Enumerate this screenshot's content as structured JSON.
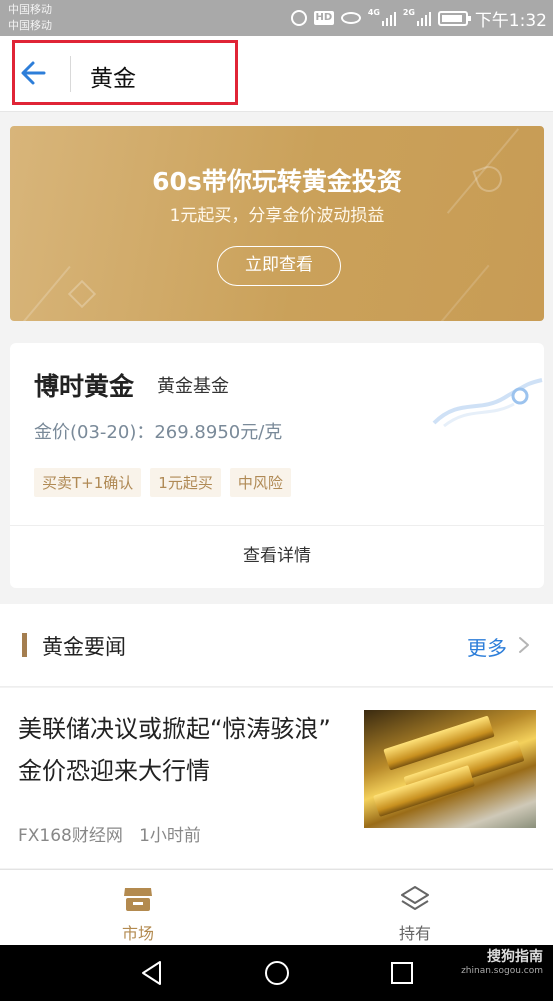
{
  "status_bar": {
    "carrier1": "中国移动",
    "carrier2": "中国移动",
    "hd": "HD",
    "net1": "4G",
    "net2": "2G",
    "time": "下午1:32"
  },
  "header": {
    "title": "黄金",
    "back_icon": "arrow-left-icon"
  },
  "banner": {
    "title": "60s带你玩转黄金投资",
    "subtitle": "1元起买，分享金价波动损益",
    "button_label": "立即查看"
  },
  "fund_card": {
    "name": "博时黄金",
    "type": "黄金基金",
    "price_line": "金价(03-20)：269.8950元/克",
    "tags": [
      "买卖T+1确认",
      "1元起买",
      "中风险"
    ],
    "link_label": "查看详情"
  },
  "news_section": {
    "title": "黄金要闻",
    "more_label": "更多"
  },
  "news_items": [
    {
      "title": "美联储决议或掀起“惊涛骇浪” 金价恐迎来大行情",
      "source": "FX168财经网",
      "time": "1小时前"
    }
  ],
  "tab_bar": {
    "tabs": [
      {
        "label": "市场",
        "icon": "store-icon",
        "active": true
      },
      {
        "label": "持有",
        "icon": "layers-icon",
        "active": false
      }
    ]
  },
  "watermark": {
    "line1": "搜狗指南",
    "line2": "zhinan.sogou.com"
  },
  "colors": {
    "accent_gold": "#b38a4f",
    "link_blue": "#2d7ed9",
    "highlight_red": "#e02436",
    "banner_gold": "#caa15a"
  }
}
